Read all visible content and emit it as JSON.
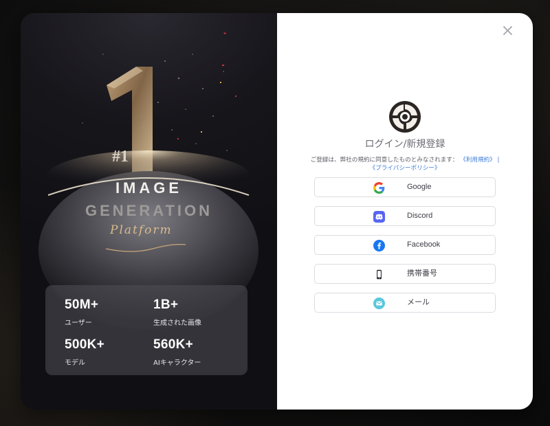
{
  "hero": {
    "rank_text": "#1",
    "line1": "IMAGE",
    "line2": "GENERATION",
    "line3": "Platform"
  },
  "stats": [
    {
      "value": "50M+",
      "label": "ユーザー"
    },
    {
      "value": "1B+",
      "label": "生成された画像"
    },
    {
      "value": "500K+",
      "label": "モデル"
    },
    {
      "value": "560K+",
      "label": "AIキャラクター"
    }
  ],
  "auth": {
    "title": "ログイン/新規登録",
    "consent_text": "ご登録は、弊社の規約に同意したものとみなされます：",
    "terms_link": "《利用規約》",
    "separator": "|",
    "privacy_link": "《プライバシーポリシー》",
    "buttons": [
      {
        "label": "Google",
        "icon": "google-icon"
      },
      {
        "label": "Discord",
        "icon": "discord-icon"
      },
      {
        "label": "Facebook",
        "icon": "facebook-icon"
      },
      {
        "label": "携帯番号",
        "icon": "phone-icon"
      },
      {
        "label": "メール",
        "icon": "email-icon"
      }
    ]
  },
  "colors": {
    "link": "#3d7bd9",
    "facebook": "#1877f2",
    "discord": "#5865f2",
    "email": "#5bc7dc"
  }
}
